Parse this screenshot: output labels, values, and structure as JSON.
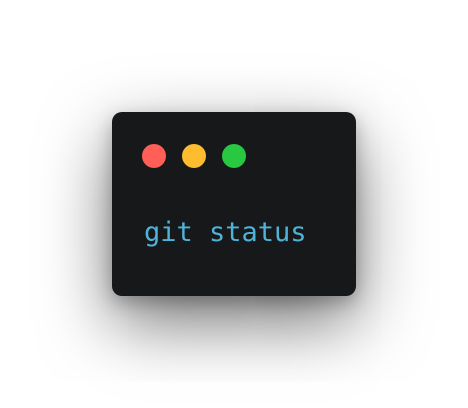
{
  "window": {
    "background": "#17181a",
    "controls": [
      {
        "name": "close",
        "color": "#ff5f57"
      },
      {
        "name": "minimize",
        "color": "#febc2e"
      },
      {
        "name": "maximize",
        "color": "#28c840"
      }
    ]
  },
  "terminal": {
    "command": "git status",
    "text_color": "#4fb3d9"
  }
}
